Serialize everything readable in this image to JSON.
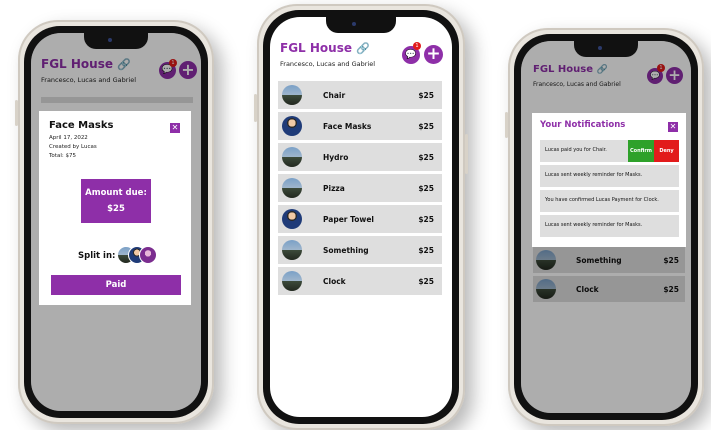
{
  "group": {
    "title": "FGL House",
    "members": "Francesco, Lucas and Gabriel",
    "notification_count": "1"
  },
  "expenses": [
    {
      "name": "Chair",
      "amount": "$25",
      "avatar": "landscape"
    },
    {
      "name": "Face Masks",
      "amount": "$25",
      "avatar": "kid"
    },
    {
      "name": "Hydro",
      "amount": "$25",
      "avatar": "landscape"
    },
    {
      "name": "Pizza",
      "amount": "$25",
      "avatar": "landscape"
    },
    {
      "name": "Paper Towel",
      "amount": "$25",
      "avatar": "kid"
    },
    {
      "name": "Something",
      "amount": "$25",
      "avatar": "landscape"
    },
    {
      "name": "Clock",
      "amount": "$25",
      "avatar": "landscape"
    }
  ],
  "detail": {
    "title": "Face Masks",
    "date": "April 17, 2022",
    "created_by": "Created by Lucas",
    "total": "Total: $75",
    "amount_label": "Amount due:",
    "amount_value": "$25",
    "split_label": "Split in:",
    "paid_label": "Paid"
  },
  "notifications": {
    "title": "Your Notifications",
    "items": [
      {
        "text": "Lucas paid you for Chair.",
        "confirm": "Confirm",
        "deny": "Deny"
      },
      {
        "text": "Lucas sent weekly reminder for Masks."
      },
      {
        "text": "You have confirmed Lucas Payment for Clock."
      },
      {
        "text": "Lucas sent weekly reminder for Masks."
      }
    ]
  },
  "colors": {
    "brand": "#8e2fa8",
    "confirm": "#2ea12a",
    "deny": "#e21b1b",
    "row": "#dedede"
  }
}
